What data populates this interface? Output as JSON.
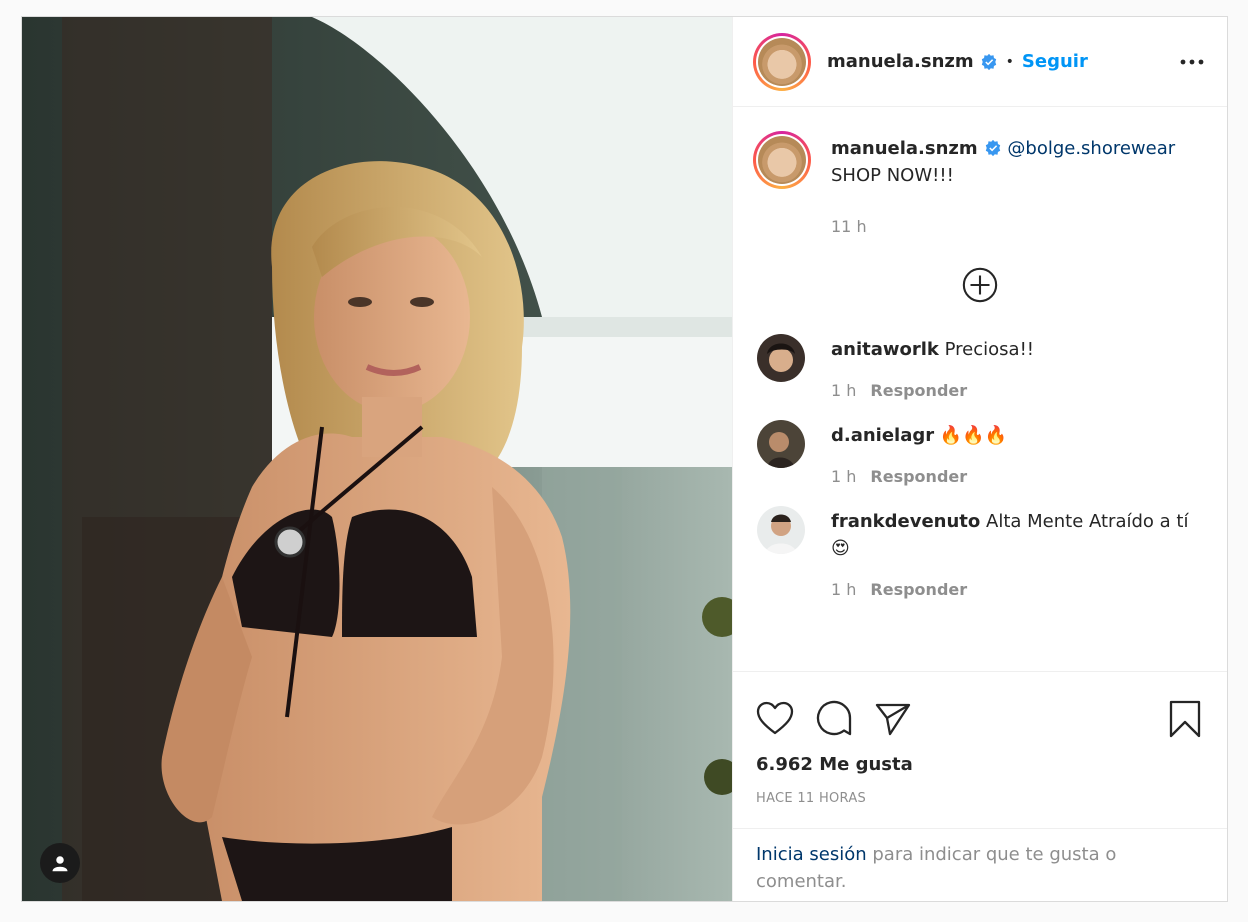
{
  "post": {
    "username": "manuela.snzm",
    "follow_label": "Seguir",
    "separator": "•",
    "caption_mention": "@bolge.shorewear",
    "caption_text": "SHOP NOW!!!",
    "caption_time": "11 h",
    "likes": "6.962 Me gusta",
    "posted_ago": "HACE 11 HORAS"
  },
  "comments": [
    {
      "user": "anitaworlk",
      "text": "Preciosa!!",
      "time": "1 h",
      "reply": "Responder"
    },
    {
      "user": "d.anielagr",
      "text": "🔥🔥🔥",
      "time": "1 h",
      "reply": "Responder"
    },
    {
      "user": "frankdevenuto",
      "text": "Alta Mente Atraído a tí 😍",
      "time": "1 h",
      "reply": "Responder"
    }
  ],
  "login_prompt": {
    "link": "Inicia sesión",
    "rest": "para indicar que te gusta o comentar."
  },
  "icons": [
    "user-tag-icon",
    "verified-badge-icon",
    "more-options-icon",
    "load-more-comments-icon",
    "like-heart-icon",
    "comment-icon",
    "share-icon",
    "save-bookmark-icon"
  ],
  "colors": {
    "accent": "#0095f6",
    "link": "#00376b",
    "muted": "#8e8e8e",
    "text": "#262626"
  }
}
